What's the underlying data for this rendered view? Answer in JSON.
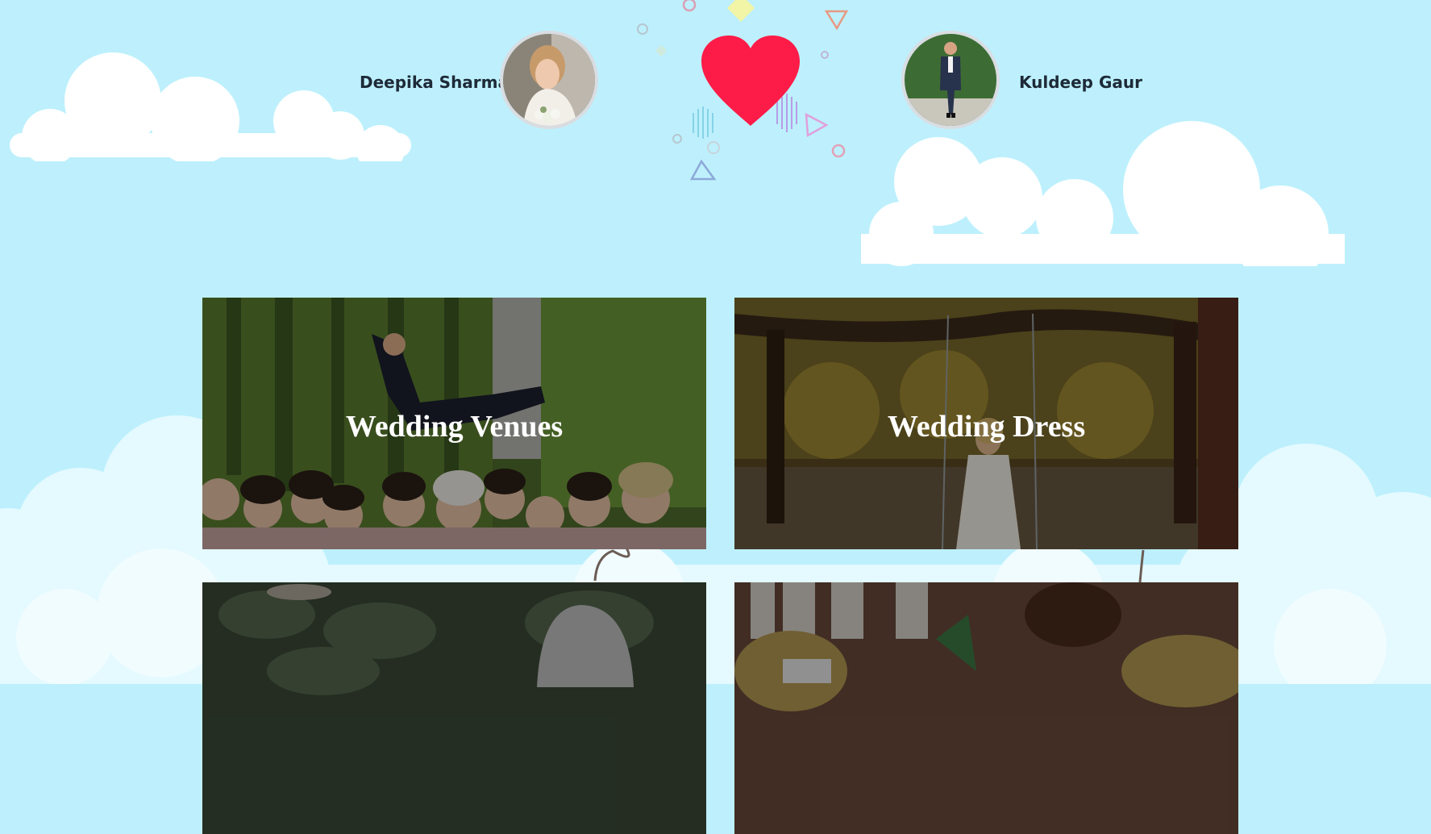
{
  "couple": {
    "bride": {
      "name": "Deepika Sharma",
      "photo_icon": "bride-photo"
    },
    "groom": {
      "name": "Kuldeep Gaur",
      "photo_icon": "groom-photo"
    },
    "center_icon": "heart-icon"
  },
  "colors": {
    "background": "#bdf0fc",
    "heart": "#fc1c47",
    "cloud": "#ffffff",
    "cloud_light": "#e4faff",
    "card_title": "#ffffff"
  },
  "cards": [
    {
      "title": "Wedding Venues",
      "image": "bridesmaids-and-groom-jumping"
    },
    {
      "title": "Wedding Dress",
      "image": "bride-on-swing-in-park"
    },
    {
      "title": "",
      "image": "person-in-hoodie-among-leaves"
    },
    {
      "title": "",
      "image": "restaurant-interior"
    }
  ]
}
